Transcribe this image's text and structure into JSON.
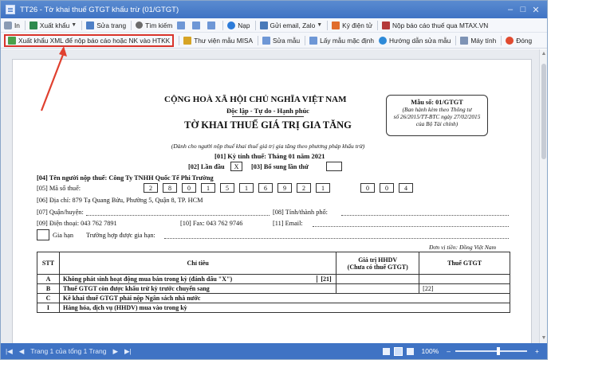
{
  "window": {
    "title": "TT26 - Tờ khai thuế GTGT khấu trừ (01/GTGT)",
    "controls": [
      "–",
      "□",
      "✕"
    ]
  },
  "toolbar1": {
    "print": "In",
    "export": "Xuất khẩu",
    "edit_page": "Sửa trang",
    "search": "Tìm kiếm",
    "load": "Nạp",
    "send": "Gửi email, Zalo",
    "esign": "Ký điện tử",
    "submit_mtax": "Nộp báo cáo thuế qua MTAX.VN"
  },
  "toolbar2": {
    "export_xml": "Xuất khẩu XML để nộp báo cáo hoặc NK vào HTKK",
    "misa_library": "Thư viện mẫu MISA",
    "edit_template": "Sửa mẫu",
    "default_template": "Lấy mẫu mặc định",
    "edit_guide": "Hướng dẫn sửa mẫu",
    "calculator": "Máy tính",
    "close": "Đóng"
  },
  "doc": {
    "republic": "CỘNG HOÀ XÃ HỘI CHỦ NGHĨA VIỆT NAM",
    "motto": "Độc lập - Tự do - Hạnh phúc",
    "title": "TỜ KHAI THUẾ GIÁ TRỊ GIA TĂNG",
    "subtitle": "(Dành cho người nộp thuế khai thuế giá trị gia tăng theo phương pháp khấu trừ)",
    "period": "[01] Kỳ tính thuế: Tháng 01 năm 2021",
    "first_time_label": "[02] Lần đầu",
    "first_time_value": "X",
    "supplement_label": "[03] Bổ sung lần thứ",
    "form_no": "Mẫu số: 01/GTGT",
    "form_note_1": "(Ban hành kèm theo Thông tư",
    "form_note_2": "số 26/2015/TT-BTC ngày 27/02/2015",
    "form_note_3": "của Bộ Tài chính)",
    "taxpayer": "[04] Tên người nộp thuế:  Công Ty TNHH Quốc Tế Phi Trường",
    "tax_code_label": "[05] Mã số thuế:",
    "tax_code_digits": [
      "2",
      "8",
      "0",
      "1",
      "5",
      "1",
      "6",
      "9",
      "2",
      "1"
    ],
    "branch_digits": [
      "0",
      "0",
      "4"
    ],
    "address": "[06] Địa chỉ:   879 Tạ Quang Bửu, Phường 5, Quận 8, TP. HCM",
    "district": "[07] Quận/huyện:",
    "province": "[08] Tỉnh/thành phố:",
    "phone": "[09] Điện thoại:   043 762 7891",
    "fax": "[10] Fax:   043 762 9746",
    "email": "[11] Email:",
    "extension": "Gia hạn",
    "extension_case": "Trường hợp được gia hạn:",
    "currency_unit": "Đơn vị tiền: Đồng Việt Nam"
  },
  "table": {
    "headers": [
      "STT",
      "Chỉ tiêu",
      "Giá trị HHDV\n(Chưa có thuế GTGT)",
      "Thuế GTGT"
    ],
    "rows": [
      [
        "A",
        "Không phát sinh hoạt động mua bán trong kỳ (đánh dấu \"X\")",
        "[21]",
        ""
      ],
      [
        "B",
        "Thuế GTGT còn được khấu trừ kỳ trước chuyển sang",
        "",
        "[22]"
      ],
      [
        "C",
        "Kê khai thuế GTGT phải nộp Ngân sách nhà nước",
        "",
        ""
      ],
      [
        "I",
        "Hàng hóa, dịch vụ (HHDV) mua vào trong kỳ",
        "",
        ""
      ]
    ]
  },
  "statusbar": {
    "page_info": "Trang 1 của tổng 1 Trang",
    "zoom": "100%",
    "minus": "–",
    "plus": "+"
  },
  "colors": {
    "accent": "#3f73c4",
    "highlight": "#d9342b"
  }
}
